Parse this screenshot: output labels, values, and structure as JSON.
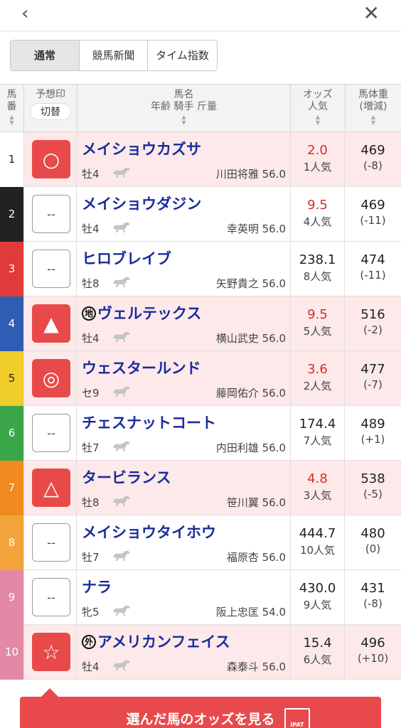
{
  "nav": {
    "back_glyph": "‹",
    "close_glyph": "✕"
  },
  "tabs": [
    "通常",
    "競馬新聞",
    "タイム指数"
  ],
  "header": {
    "num_line1": "馬",
    "num_line2": "番",
    "mark_label": "予想印",
    "switch_label": "切替",
    "name_line1": "馬名",
    "name_line2": "年齢 騎手 斤量",
    "odds_line1": "オッズ",
    "odds_line2": "人気",
    "weight_line1": "馬体重",
    "weight_line2": "(増減)"
  },
  "frame_colors": [
    "#ffffff",
    "#222222",
    "#e03b3b",
    "#2f5db3",
    "#f0cd2b",
    "#3aa64a",
    "#ef8a1e",
    "#f2a33a",
    "#e389a5",
    "#e389a5"
  ],
  "rows": [
    {
      "num": "1",
      "mark": "○",
      "mark_style": "red",
      "tag": "",
      "name": "メイショウカズサ",
      "sex_age": "牡4",
      "jockey": "川田将雅 56.0",
      "odds": "2.0",
      "odds_red": true,
      "popularity": "1人気",
      "weight": "469",
      "diff": "(-8)",
      "highlight": true
    },
    {
      "num": "2",
      "mark": "--",
      "mark_style": "blank",
      "tag": "",
      "name": "メイショウダジン",
      "sex_age": "牡4",
      "jockey": "幸英明 56.0",
      "odds": "9.5",
      "odds_red": true,
      "popularity": "4人気",
      "weight": "469",
      "diff": "(-11)",
      "highlight": false
    },
    {
      "num": "3",
      "mark": "--",
      "mark_style": "blank",
      "tag": "",
      "name": "ヒロブレイブ",
      "sex_age": "牡8",
      "jockey": "矢野貴之 56.0",
      "odds": "238.1",
      "odds_red": false,
      "popularity": "8人気",
      "weight": "474",
      "diff": "(-11)",
      "highlight": false
    },
    {
      "num": "4",
      "mark": "▲",
      "mark_style": "red",
      "tag": "地",
      "name": "ヴェルテックス",
      "sex_age": "牡4",
      "jockey": "横山武史 56.0",
      "odds": "9.5",
      "odds_red": true,
      "popularity": "5人気",
      "weight": "516",
      "diff": "(-2)",
      "highlight": true
    },
    {
      "num": "5",
      "mark": "◎",
      "mark_style": "red",
      "tag": "",
      "name": "ウェスタールンド",
      "sex_age": "セ9",
      "jockey": "藤岡佑介 56.0",
      "odds": "3.6",
      "odds_red": true,
      "popularity": "2人気",
      "weight": "477",
      "diff": "(-7)",
      "highlight": true
    },
    {
      "num": "6",
      "mark": "--",
      "mark_style": "blank",
      "tag": "",
      "name": "チェスナットコート",
      "sex_age": "牡7",
      "jockey": "内田利雄 56.0",
      "odds": "174.4",
      "odds_red": false,
      "popularity": "7人気",
      "weight": "489",
      "diff": "(+1)",
      "highlight": false
    },
    {
      "num": "7",
      "mark": "△",
      "mark_style": "red",
      "tag": "",
      "name": "タービランス",
      "sex_age": "牡8",
      "jockey": "笹川翼 56.0",
      "odds": "4.8",
      "odds_red": true,
      "popularity": "3人気",
      "weight": "538",
      "diff": "(-5)",
      "highlight": true
    },
    {
      "num": "8",
      "mark": "--",
      "mark_style": "blank",
      "tag": "",
      "name": "メイショウタイホウ",
      "sex_age": "牡7",
      "jockey": "福原杏 56.0",
      "odds": "444.7",
      "odds_red": false,
      "popularity": "10人気",
      "weight": "480",
      "diff": "(0)",
      "highlight": false
    },
    {
      "num": "9",
      "mark": "--",
      "mark_style": "blank",
      "tag": "",
      "name": "ナラ",
      "sex_age": "牝5",
      "jockey": "阪上忠匡 54.0",
      "odds": "430.0",
      "odds_red": false,
      "popularity": "9人気",
      "weight": "431",
      "diff": "(-8)",
      "highlight": false
    },
    {
      "num": "10",
      "mark": "☆",
      "mark_style": "red",
      "tag": "外",
      "name": "アメリカンフェイス",
      "sex_age": "牡4",
      "jockey": "森泰斗 56.0",
      "odds": "15.4",
      "odds_red": false,
      "popularity": "6人気",
      "weight": "496",
      "diff": "(+10)",
      "highlight": true
    }
  ],
  "cta": {
    "label": "選んだ馬のオッズを見る",
    "icon_text": "IPAT"
  }
}
